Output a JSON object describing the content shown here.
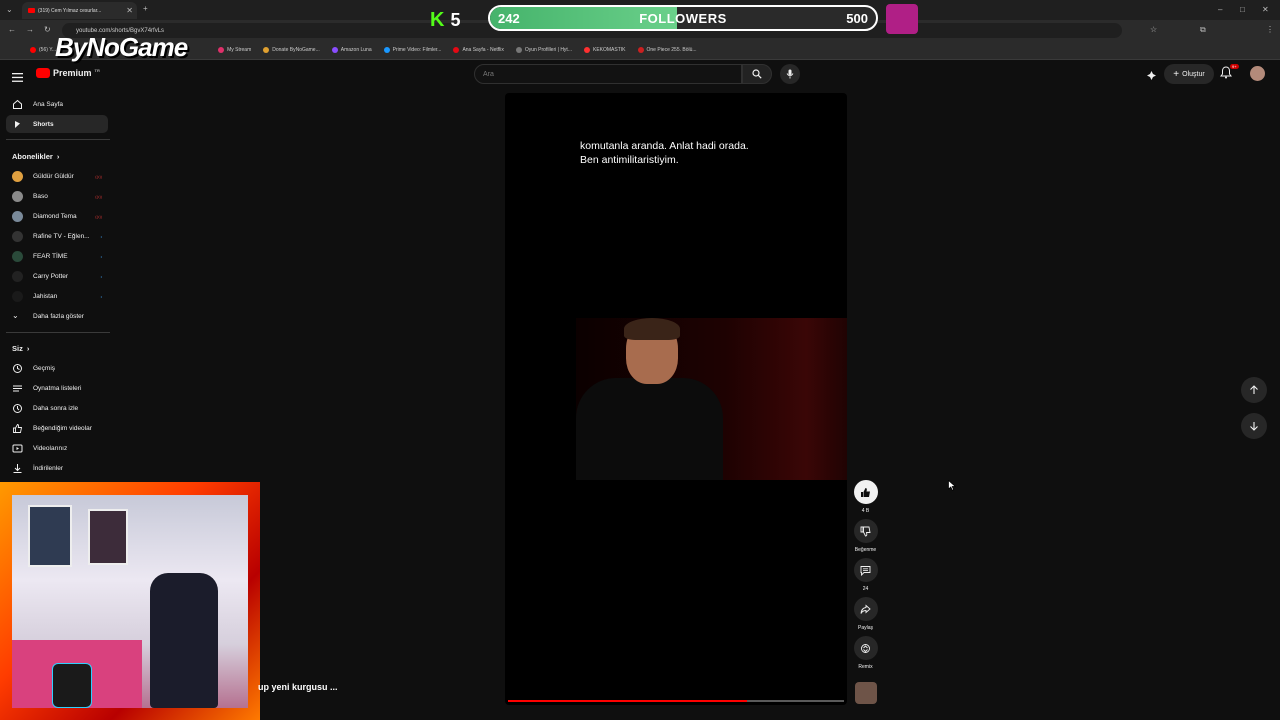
{
  "browser": {
    "tab_title": "(319) Cem Yılmaz cesurlar...",
    "url": "youtube.com/shorts/BgvX74rfvLs",
    "bookmarks": [
      {
        "label": "(56) Y...",
        "color": "#ff0000"
      },
      {
        "label": "My Stream",
        "color": "#e0306a"
      },
      {
        "label": "Donate ByNoGame...",
        "color": "#e0a030"
      },
      {
        "label": "Amazon Luna",
        "color": "#8a4dff"
      },
      {
        "label": "Prime Video: Filmler...",
        "color": "#1a98ff"
      },
      {
        "label": "Ana Sayfa - Netflix",
        "color": "#e50914"
      },
      {
        "label": "Oyun Profilleri | Hyt...",
        "color": "#777777"
      },
      {
        "label": "KEKOMASTIK",
        "color": "#ff3030"
      },
      {
        "label": "One Piece 255. Bölü...",
        "color": "#cc2020"
      }
    ]
  },
  "overlay": {
    "kick_count": "5",
    "followers_current": "242",
    "followers_label": "FOLLOWERS",
    "followers_goal": "500",
    "followers_fraction": 0.484,
    "logo_text": "ByNoGame"
  },
  "youtube": {
    "logo_text": "Premium",
    "logo_sup": "TR",
    "search_placeholder": "Ara",
    "create_label": "Oluştur",
    "notif_badge": "9+"
  },
  "sidebar": {
    "main": [
      {
        "label": "Ana Sayfa",
        "icon": "home-icon",
        "active": false
      },
      {
        "label": "Shorts",
        "icon": "shorts-icon",
        "active": true
      }
    ],
    "subs_heading": "Abonelikler",
    "subs": [
      {
        "label": "Güldür Güldür",
        "color": "#e0a040",
        "live": true
      },
      {
        "label": "Baso",
        "color": "#8a8a8a",
        "live": true
      },
      {
        "label": "Diamond Tema",
        "color": "#7a8a9a",
        "live": true
      },
      {
        "label": "Rafine TV - Eğlen...",
        "color": "#333333",
        "live": false
      },
      {
        "label": "FEAR TİME",
        "color": "#2a4a3a",
        "live": false
      },
      {
        "label": "Carry Potter",
        "color": "#222222",
        "live": false
      },
      {
        "label": "Jahistan",
        "color": "#1a1a1a",
        "live": false
      }
    ],
    "show_more": "Daha fazla göster",
    "you_heading": "Siz",
    "you_items": [
      {
        "label": "Geçmiş",
        "icon": "history-icon"
      },
      {
        "label": "Oynatma listeleri",
        "icon": "playlists-icon"
      },
      {
        "label": "Daha sonra izle",
        "icon": "watch-later-icon"
      },
      {
        "label": "Beğendiğim videolar",
        "icon": "liked-icon"
      },
      {
        "label": "Videolarınız",
        "icon": "your-videos-icon"
      },
      {
        "label": "İndirilenler",
        "icon": "downloads-icon"
      }
    ]
  },
  "short": {
    "subtitle_line1": "komutanla aranda. Anlat hadi orada.",
    "subtitle_line2": "Ben antimilitaristiyim.",
    "progress_fraction": 0.71,
    "title_partial": "up yeni kurgusu ...",
    "actions": {
      "like_count": "4 B",
      "dislike_label": "Beğenme",
      "comments_count": "24",
      "share_label": "Paylaş",
      "remix_label": "Remix"
    }
  }
}
